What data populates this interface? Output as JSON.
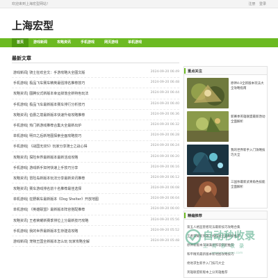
{
  "topbar": {
    "welcome": "欢迎来到上海宏型网站！",
    "login": "注册",
    "register": "登录"
  },
  "logo": "上海宏型",
  "nav": [
    "首页",
    "游戏新闻",
    "攻略资讯",
    "手机游戏",
    "网页游戏",
    "单机游戏"
  ],
  "section_title": "最新文章",
  "articles": [
    {
      "title": "游戏新闻| 骑士狂欢全文：手游攻略大全图文版",
      "date": "2024-09-20 06:49"
    },
    {
      "title": "手机游戏| 极品飞车赛车精英最强排名推荐技巧",
      "date": "2024-09-20 06:48"
    },
    {
      "title": "攻略资讯| 图腾仪式新版本幸运掉落全新特色玩法",
      "date": "2024-09-20 06:44"
    },
    {
      "title": "手机游戏| 极品飞车最新版本赛车排行分析技巧",
      "date": "2024-09-20 06:40"
    },
    {
      "title": "攻略资讯| 伯爵之境最新版本快速升级攻略推荐",
      "date": "2024-09-20 06:36"
    },
    {
      "title": "手机游戏| 热门新游戏推荐合集大全最新出炉",
      "date": "2024-09-20 06:32"
    },
    {
      "title": "单机游戏| 明日之后新地图探索全面攻略技巧",
      "date": "2024-09-20 06:28"
    },
    {
      "title": "手机游戏| 《战国无双5》玩家分享骑士之战心得",
      "date": "2024-09-20 06:24"
    },
    {
      "title": "攻略资讯| 探险世界最新版本最新活动攻略",
      "date": "2024-09-20 06:20"
    },
    {
      "title": "手机游戏| 游戏新手如何快速上手技巧分享",
      "date": "2024-09-20 06:16"
    },
    {
      "title": "攻略资讯| 冒险岛新版本玩法分享最新资讯推荐",
      "date": "2024-09-20 06:12"
    },
    {
      "title": "攻略资讯| 赛车游戏排名前十名推荐最佳选择",
      "date": "2024-09-20 06:08"
    },
    {
      "title": "单机游戏| 狂野飙车最新版本《Dog Shelter》开放地图",
      "date": "2024-09-20 06:04"
    },
    {
      "title": "单机游戏| 《英雄联盟》最新版本阵容搭配推荐",
      "date": "2024-09-20 06:00"
    },
    {
      "title": "攻略资讯| 王者荣耀新赛季排位上分最新技巧攻略",
      "date": "2024-09-20 05:56"
    },
    {
      "title": "手机游戏| 我的世界最新版本生存建造攻略",
      "date": "2024-09-20 05:52"
    },
    {
      "title": "游戏新闻| 宠物王国全新版本怎么玩 玩家攻略全解",
      "date": "2024-09-20 05:48"
    }
  ],
  "sidebar": {
    "title": "重点关注",
    "cards": [
      {
        "title": "原神4.0全新版本玩法大全攻略指南"
      },
      {
        "title": "新赛季英雄联盟最新改动全面解析"
      },
      {
        "title": "我的世界新手入门攻略技巧大全"
      },
      {
        "title": "三国杀最新武将角色技能全面解析"
      }
    ]
  },
  "sidebar2": {
    "title": "精编推荐",
    "items": [
      "第五人格监管者玩法最新技巧攻略合集",
      "王者荣耀新英雄上线技能全面解析推荐",
      "原神新版本深渊满星阵容搭配推荐",
      "和平精英最新版本新地图攻略技巧",
      "绝地求生新手入门技巧大全",
      "英雄联盟新版本上分英雄推荐"
    ]
  },
  "watermark": {
    "main": "自动秒收录",
    "sub": "上传秒收录",
    "url": "www.xxxxxxxx.com"
  },
  "colors": {
    "accent": "#6cba22",
    "accent_dark": "#4e9a11"
  }
}
